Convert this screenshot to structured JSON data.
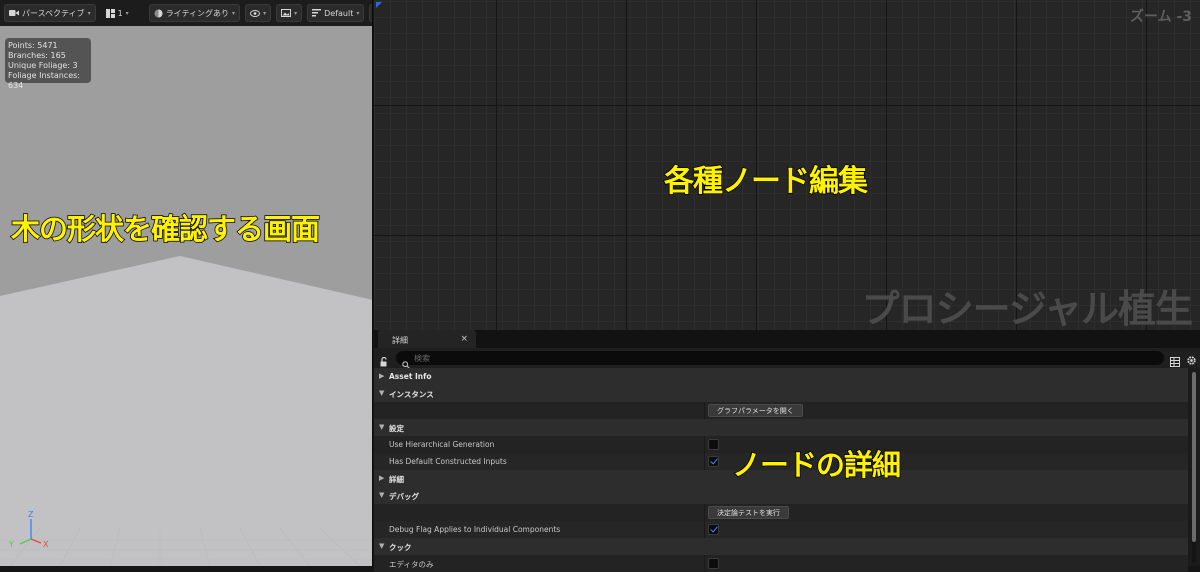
{
  "viewport": {
    "toolbar": {
      "perspective_label": "パースペクティブ",
      "view_count": "1",
      "lighting_label": "ライティングあり",
      "preset_label": "Default"
    },
    "stats": {
      "points": "Points: 5471",
      "branches": "Branches: 165",
      "unique_foliage": "Unique Foliage: 3",
      "foliage_instances": "Foliage Instances: 634"
    },
    "axis": {
      "z": "Z",
      "y": "Y",
      "x": "X"
    },
    "caption": "木の形状を確認する画面",
    "colors": {
      "sky": "#9e9e9e",
      "floor": "#c2c2c4",
      "caption": "#fff200"
    }
  },
  "graph": {
    "zoom_label": "ズーム -3",
    "caption": "各種ノード編集",
    "watermark": "プロシージャル植生"
  },
  "details": {
    "tab_label": "詳細",
    "tab_close": "×",
    "search_placeholder": "検索",
    "rows": [
      {
        "kind": "section",
        "label": "Asset Info",
        "expanded": false
      },
      {
        "kind": "section",
        "label": "インスタンス",
        "expanded": true
      },
      {
        "kind": "button",
        "button_label": "グラフパラメータを開く"
      },
      {
        "kind": "section",
        "label": "設定",
        "expanded": true
      },
      {
        "kind": "check",
        "label": "Use Hierarchical Generation",
        "checked": false
      },
      {
        "kind": "check",
        "label": "Has Default Constructed Inputs",
        "checked": true
      },
      {
        "kind": "section",
        "label": "詳細",
        "expanded": false
      },
      {
        "kind": "section",
        "label": "デバッグ",
        "expanded": true
      },
      {
        "kind": "button",
        "button_label": "決定論テストを実行"
      },
      {
        "kind": "check",
        "label": "Debug Flag Applies to Individual Components",
        "checked": true
      },
      {
        "kind": "section",
        "label": "クック",
        "expanded": true
      },
      {
        "kind": "check",
        "label": "エディタのみ",
        "checked": false
      }
    ],
    "caption": "ノードの詳細",
    "accent": "#3d8cff"
  }
}
